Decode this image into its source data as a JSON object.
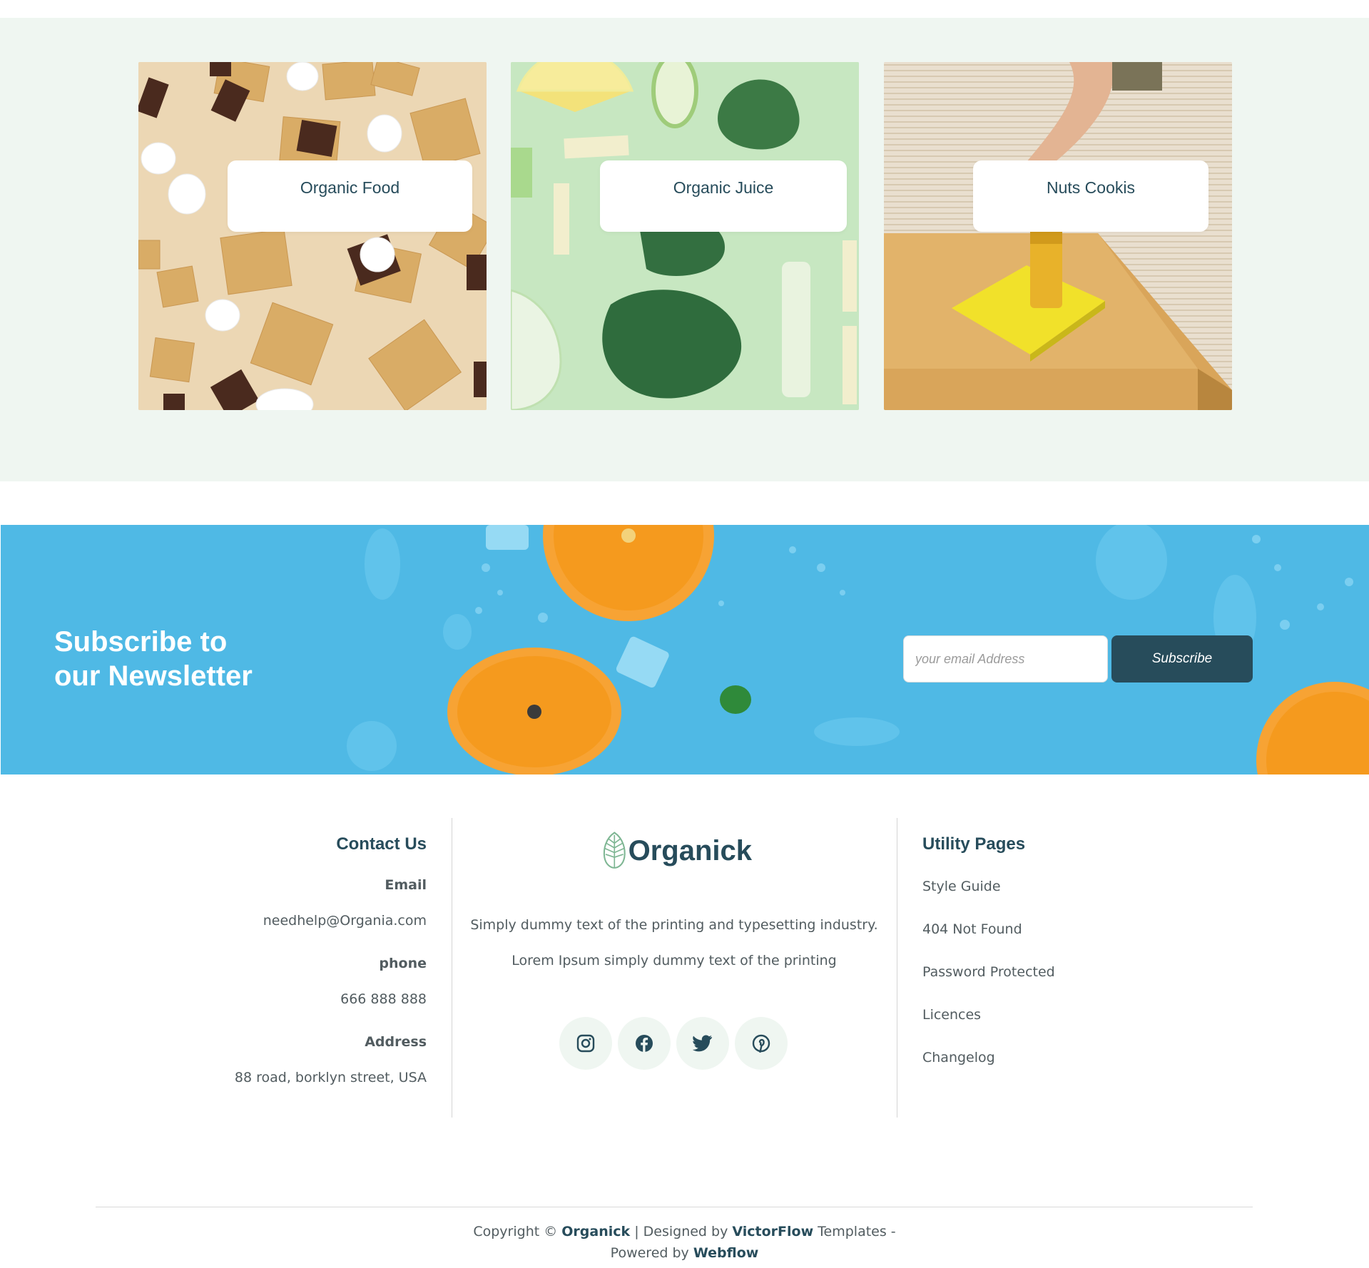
{
  "categories": [
    {
      "label": "Organic Food"
    },
    {
      "label": "Organic Juice"
    },
    {
      "label": "Nuts Cookis"
    }
  ],
  "newsletter": {
    "title_line1": "Subscribe to",
    "title_line2": "our Newsletter",
    "email_placeholder": "your email Address",
    "button_label": "Subscribe"
  },
  "footer": {
    "contact": {
      "heading": "Contact Us",
      "email_label": "Email",
      "email_value": "needhelp@Organia.com",
      "phone_label": "phone",
      "phone_value": "666 888 888",
      "address_label": "Address",
      "address_value": "88 road, borklyn street, USA"
    },
    "brand": {
      "name": "Organick",
      "desc_line1": "Simply dummy text of the printing and typesetting industry.",
      "desc_line2": "Lorem Ipsum simply dummy text of the printing",
      "socials": [
        "instagram-icon",
        "facebook-icon",
        "twitter-icon",
        "pinterest-icon"
      ]
    },
    "utility": {
      "heading": "Utility Pages",
      "links": [
        "Style Guide",
        "404 Not Found",
        "Password Protected",
        "Licences",
        "Changelog"
      ]
    },
    "copyright": {
      "prefix": "Copyright © ",
      "brand": "Organick",
      "mid": " | Designed by ",
      "designer": "VictorFlow",
      "suffix": " Templates -",
      "powered_prefix": "Powered by ",
      "powered_by": "Webflow"
    }
  },
  "colors": {
    "primary": "#274c5b",
    "section_bg": "#eff6f1",
    "newsletter_bg": "#4fb9e5",
    "text_muted": "#525c60"
  }
}
